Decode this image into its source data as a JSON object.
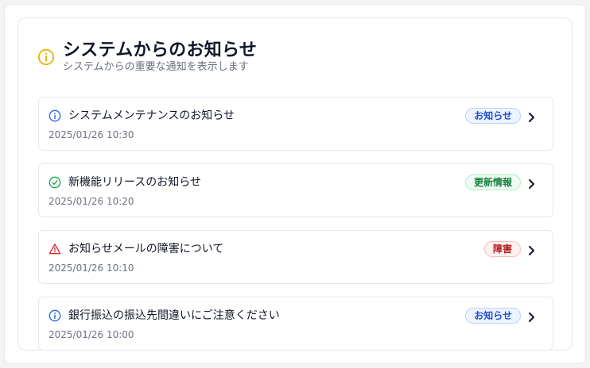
{
  "header": {
    "title": "システムからのお知らせ",
    "subtitle": "システムからの重要な通知を表示します",
    "icon": "info-circle-icon"
  },
  "colors": {
    "header_icon": "#eab308",
    "info": "#2563eb",
    "update": "#16a34a",
    "alert": "#dc2626"
  },
  "notifications": [
    {
      "title": "システムメンテナンスのお知らせ",
      "date": "2025/01/26 10:30",
      "badge": "お知らせ",
      "type": "info",
      "icon": "info-circle-icon"
    },
    {
      "title": "新機能リリースのお知らせ",
      "date": "2025/01/26 10:20",
      "badge": "更新情報",
      "type": "update",
      "icon": "check-circle-icon"
    },
    {
      "title": "お知らせメールの障害について",
      "date": "2025/01/26 10:10",
      "badge": "障害",
      "type": "alert",
      "icon": "warning-triangle-icon"
    },
    {
      "title": "銀行振込の振込先間違いにご注意ください",
      "date": "2025/01/26 10:00",
      "badge": "お知らせ",
      "type": "info",
      "icon": "info-circle-icon"
    }
  ]
}
